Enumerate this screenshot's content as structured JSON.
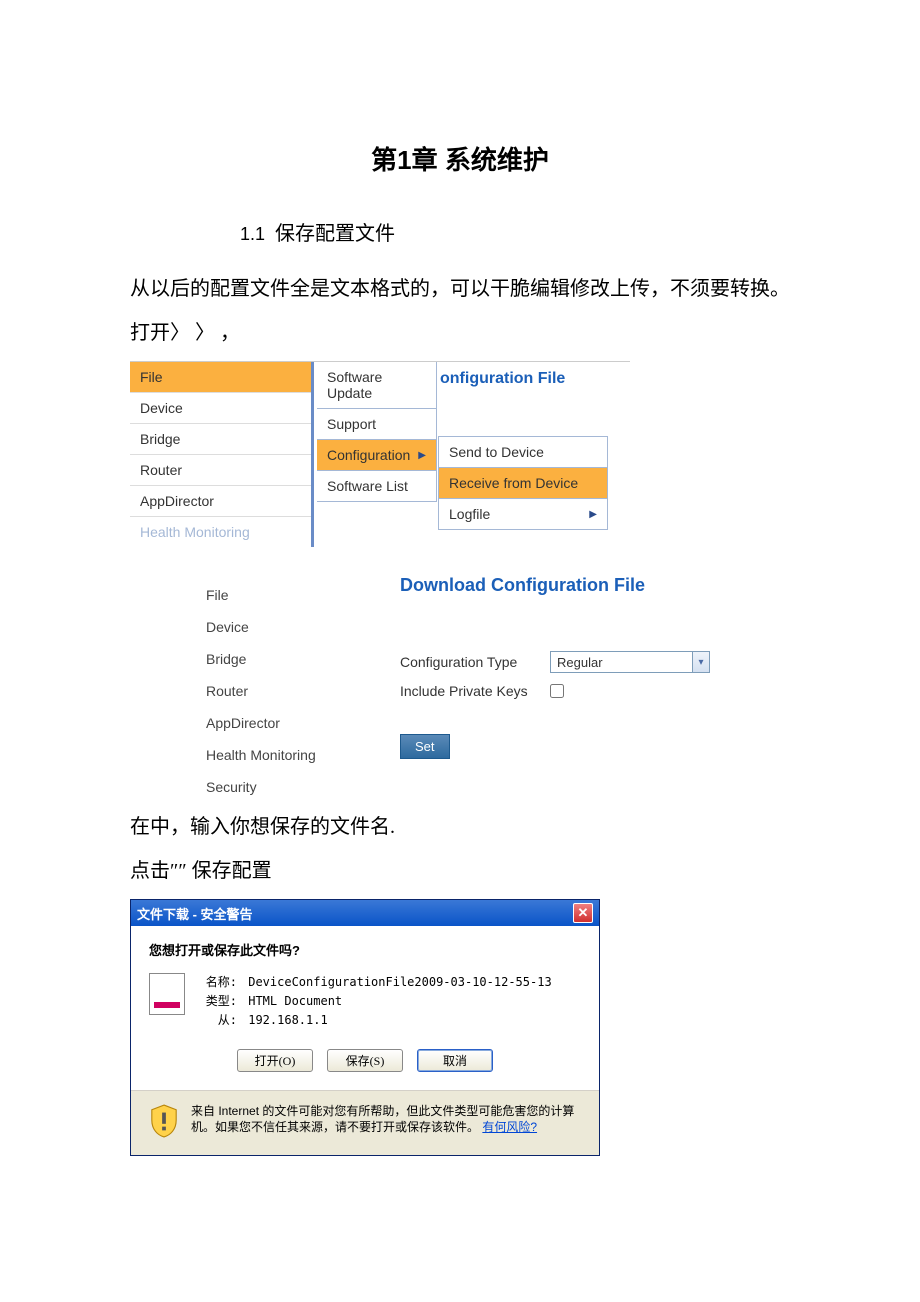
{
  "chapter": {
    "title": "第1章  系统维护"
  },
  "section": {
    "num": "1.1",
    "title": "保存配置文件"
  },
  "para1": "从以后的配置文件全是文本格式的，可以干脆编辑修改上传，不须要转换。",
  "para2": "打开〉 〉   ，",
  "shot1": {
    "partial_title": "onfiguration File",
    "col1": [
      "File",
      "Device",
      "Bridge",
      "Router",
      "AppDirector",
      "Health Monitoring"
    ],
    "col2": [
      "Software Update",
      "Support",
      "Configuration",
      "Software List"
    ],
    "col3": [
      "Send to Device",
      "Receive from Device",
      "Logfile"
    ]
  },
  "shot2": {
    "col1": [
      "File",
      "Device",
      "Bridge",
      "Router",
      "AppDirector",
      "Health Monitoring",
      "Security"
    ],
    "panel_title": "Download Configuration File",
    "row1_label": "Configuration Type",
    "row1_value": "Regular",
    "row2_label": "Include Private Keys",
    "set_btn": "Set"
  },
  "para3": "在中，输入你想保存的文件名.",
  "para4": "点击″″ 保存配置",
  "dlg": {
    "title": "文件下载 - 安全警告",
    "question": "您想打开或保存此文件吗?",
    "name_label": "名称:",
    "name_value": "DeviceConfigurationFile2009-03-10-12-55-13",
    "type_label": "类型:",
    "type_value": "HTML Document",
    "from_label": "从:",
    "from_value": "192.168.1.1",
    "btn_open": "打开(O)",
    "btn_save": "保存(S)",
    "btn_cancel": "取消",
    "footer_text": "来自 Internet 的文件可能对您有所帮助，但此文件类型可能危害您的计算机。如果您不信任其来源，请不要打开或保存该软件。",
    "footer_link": "有何风险?"
  }
}
